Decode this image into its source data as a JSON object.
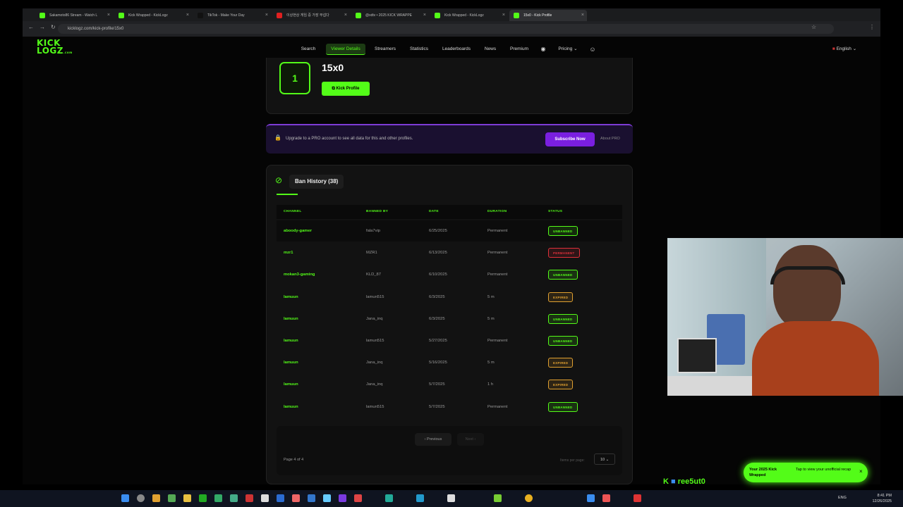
{
  "browser": {
    "tabs": [
      {
        "title": "Sakamoto86 Stream - Watch L",
        "color": "#53fc18"
      },
      {
        "title": "Kick Wrapped - KickLogz",
        "color": "#53fc18"
      },
      {
        "title": "TikTok - Make Your Day",
        "color": "#111111"
      },
      {
        "title": "이상현상 게임 중 가장 무섭다",
        "color": "#e02020"
      },
      {
        "title": "@xdtv • 2025 KICK WRAPPE",
        "color": "#53fc18"
      },
      {
        "title": "Kick Wrapped - KickLogz",
        "color": "#53fc18"
      },
      {
        "title": "15x0 - Kick Profile",
        "color": "#53fc18"
      }
    ],
    "url": "kicklogz.com/kick-profile/15x0"
  },
  "site": {
    "logo_top": "KICK",
    "logo_bottom": "LOGZ",
    "logo_suffix": ".com",
    "nav": [
      {
        "label": "Search"
      },
      {
        "label": "Viewer Details"
      },
      {
        "label": "Streamers"
      },
      {
        "label": "Statistics"
      },
      {
        "label": "Leaderboards"
      },
      {
        "label": "News"
      },
      {
        "label": "Premium"
      },
      {
        "label": "Pricing"
      }
    ],
    "language": "English"
  },
  "profile": {
    "rank": "1",
    "username": "15x0",
    "kick_profile_label": "Kick Profile"
  },
  "pro_banner": {
    "text": "Upgrade to a PRO account to see all data for this and other profiles.",
    "subscribe_label": "Subscribe Now",
    "about_label": "About PRO"
  },
  "ban_history": {
    "title": "Ban History (38)",
    "columns": [
      "CHANNEL",
      "BANNED BY",
      "DATE",
      "DURATION",
      "STATUS"
    ],
    "rows": [
      {
        "channel": "aboody-gamer",
        "banned_by": "fala7vip",
        "date": "6/25/2025",
        "duration": "Permanent",
        "status": "UNBANNED"
      },
      {
        "channel": "mzr1",
        "banned_by": "MZR1",
        "date": "6/13/2025",
        "duration": "Permanent",
        "status": "PERMANENT"
      },
      {
        "channel": "mokan3-gaming",
        "banned_by": "KLD_87",
        "date": "6/10/2025",
        "duration": "Permanent",
        "status": "UNBANNED"
      },
      {
        "channel": "lamuun",
        "banned_by": "lamun515",
        "date": "6/3/2025",
        "duration": "5 m",
        "status": "EXPIRED"
      },
      {
        "channel": "lamuun",
        "banned_by": "Jana_inq",
        "date": "6/3/2025",
        "duration": "5 m",
        "status": "UNBANNED"
      },
      {
        "channel": "lamuun",
        "banned_by": "lamun515",
        "date": "5/27/2025",
        "duration": "Permanent",
        "status": "UNBANNED"
      },
      {
        "channel": "lamuun",
        "banned_by": "Jana_inq",
        "date": "5/16/2025",
        "duration": "5 m",
        "status": "EXPIRED"
      },
      {
        "channel": "lamuun",
        "banned_by": "Jana_inq",
        "date": "5/7/2025",
        "duration": "1 h",
        "status": "EXPIRED"
      },
      {
        "channel": "lamuun",
        "banned_by": "lamun515",
        "date": "5/7/2025",
        "duration": "Permanent",
        "status": "UNBANNED"
      }
    ],
    "status_colors": {
      "UNBANNED": "#53fc18",
      "PERMANENT": "#e0303a",
      "EXPIRED": "#e0a030"
    },
    "pagination": {
      "previous_label": "‹ Previous",
      "next_label": "Next ›",
      "page_info": "Page 4 of 4",
      "per_page_label": "Items per page:",
      "per_page_value": "10"
    }
  },
  "overlay": {
    "toast_title": "Your 2025 Kick Wrapped",
    "toast_body": "Tap to view your unofficial recap",
    "chat_user": "ree5ut0"
  },
  "taskbar": {
    "language": "ENG",
    "time": "8:41 PM",
    "date": "12/26/2025"
  },
  "colors": {
    "accent": "#53fc18",
    "pro": "#7a1fe0"
  }
}
